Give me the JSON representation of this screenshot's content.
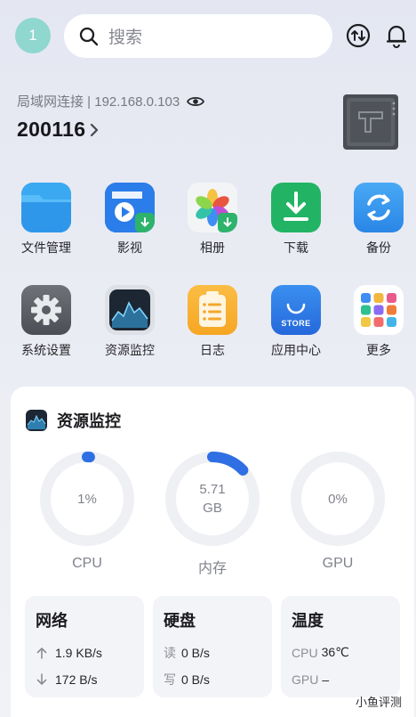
{
  "header": {
    "avatar_text": "1",
    "search_placeholder": "搜索",
    "icons": [
      "search-icon",
      "transfer-icon",
      "bell-icon"
    ]
  },
  "device": {
    "connection": "局域网连接 | 192.168.0.103",
    "name": "200116",
    "icons": [
      "eye-icon",
      "chevron-right-icon",
      "nas-device-image"
    ]
  },
  "apps": [
    {
      "label": "文件管理",
      "icon": "folder-icon"
    },
    {
      "label": "影视",
      "icon": "video-icon"
    },
    {
      "label": "相册",
      "icon": "photos-icon"
    },
    {
      "label": "下载",
      "icon": "download-icon"
    },
    {
      "label": "备份",
      "icon": "backup-icon"
    },
    {
      "label": "系统设置",
      "icon": "settings-icon"
    },
    {
      "label": "资源监控",
      "icon": "monitor-icon"
    },
    {
      "label": "日志",
      "icon": "log-icon"
    },
    {
      "label": "应用中心",
      "icon": "store-icon",
      "icon_text": "STORE"
    },
    {
      "label": "更多",
      "icon": "more-apps-icon"
    }
  ],
  "monitor": {
    "title": "资源监控",
    "gauges": [
      {
        "label": "CPU",
        "value_line1": "1%",
        "value_line2": "",
        "fraction": 0.01
      },
      {
        "label": "内存",
        "value_line1": "5.71",
        "value_line2": "GB",
        "fraction": 0.13
      },
      {
        "label": "GPU",
        "value_line1": "0%",
        "value_line2": "",
        "fraction": 0
      }
    ],
    "network": {
      "title": "网络",
      "upload": "1.9 KB/s",
      "download": "172 B/s"
    },
    "disk": {
      "title": "硬盘",
      "read_key": "读",
      "read": "0 B/s",
      "write_key": "写",
      "write": "0 B/s"
    },
    "temperature": {
      "title": "温度",
      "cpu_key": "CPU",
      "cpu": "36℃",
      "gpu_key": "GPU",
      "gpu": "–"
    },
    "colors": {
      "gauge_track": "#eef0f4",
      "gauge_fill": "#2f6fe3"
    }
  },
  "watermark": "小鱼评测"
}
